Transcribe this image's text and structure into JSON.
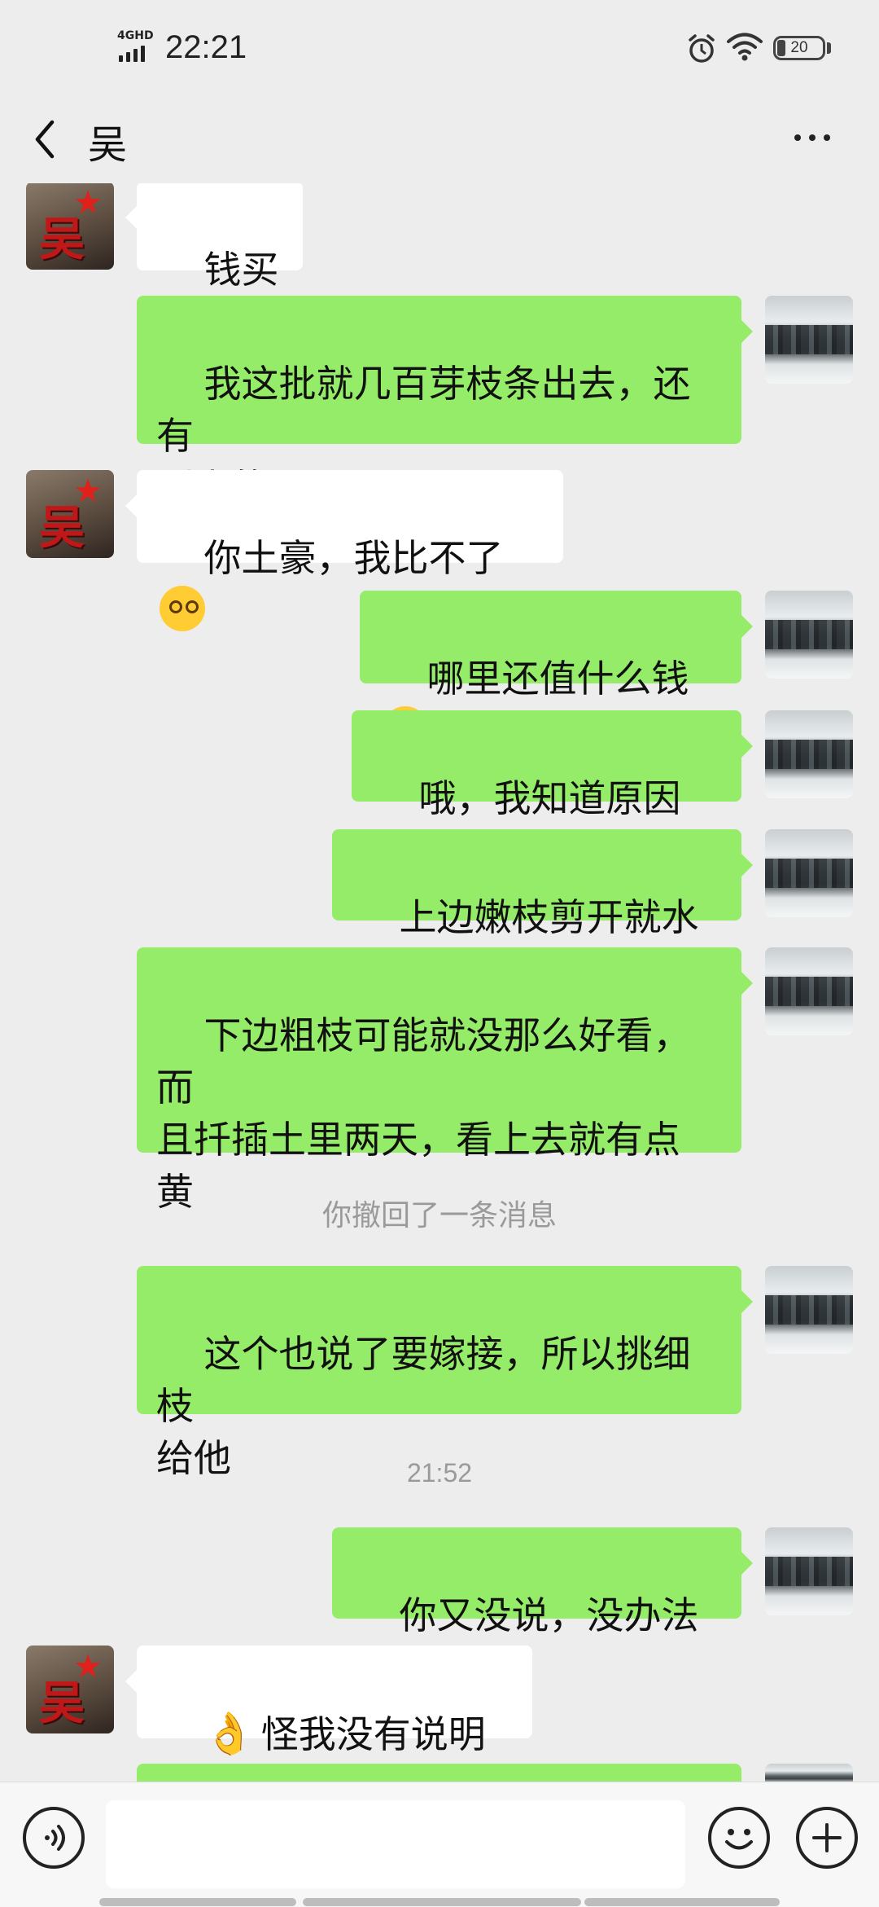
{
  "status_bar": {
    "network": "4GHD",
    "time": "22:21",
    "battery": "20",
    "icons": [
      "signal-icon",
      "alarm-icon",
      "wifi-icon",
      "battery-icon"
    ]
  },
  "header": {
    "back_icon": "chevron-left-icon",
    "title": "吴",
    "more_icon": "more-dots-icon"
  },
  "messages": [
    {
      "sender": "them",
      "text": "钱买的"
    },
    {
      "sender": "me",
      "text": "我这批就几百芽枝条出去，还有\n别人的"
    },
    {
      "sender": "them",
      "text": "你土豪，我比不了",
      "emoji": "woozy-face-emoji"
    },
    {
      "sender": "me",
      "text": "哪里还值什么钱",
      "emoji": "eye-roll-sweat-emoji"
    },
    {
      "sender": "me",
      "text": "哦，我知道原因了。"
    },
    {
      "sender": "me",
      "text": "上边嫩枝剪开就水嫩"
    },
    {
      "sender": "me",
      "text": "下边粗枝可能就没那么好看，而\n且扦插土里两天，看上去就有点\n黄"
    },
    {
      "sender": "system",
      "text": "你撤回了一条消息"
    },
    {
      "sender": "me",
      "text": "这个也说了要嫁接，所以挑细枝\n给他"
    },
    {
      "sender": "timestamp",
      "text": "21:52"
    },
    {
      "sender": "me",
      "text": "你又没说，没办法啦"
    },
    {
      "sender": "them",
      "text": "怪我没有说明白",
      "emoji": "ok-hand-emoji"
    }
  ],
  "avatars": {
    "them_char": "吴"
  },
  "input_bar": {
    "voice_icon": "voice-icon",
    "emoji_icon": "smiley-icon",
    "plus_icon": "plus-icon",
    "placeholder": ""
  }
}
